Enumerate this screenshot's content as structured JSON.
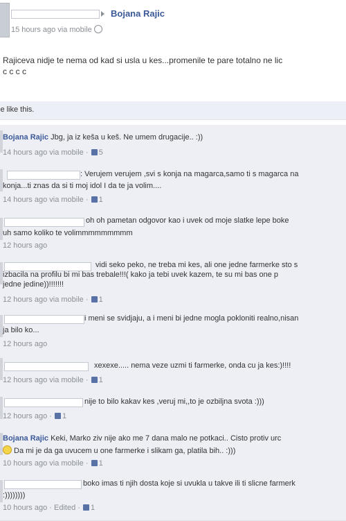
{
  "post": {
    "author": "Bojana Rajic",
    "time": "15 hours ago via mobile",
    "text_line1": "Rajiceva nidje te nema od kad si usla u kes...promenile te pare totalno ne lic",
    "text_line2": "c c c c",
    "likes_text": "le like this."
  },
  "comments": [
    {
      "author": "Bojana Rajic",
      "text1": "Jbg, ja iz keša u keš. Ne umem drugacije.. :))",
      "text2": "",
      "time": "14 hours ago via mobile",
      "likes": "5"
    },
    {
      "author": "",
      "text1": ": Verujem verujem ,svi s konja na magarca,samo ti s magarca na",
      "text2": "konja...ti znas da si ti moj idol I da te ja volim....",
      "time": "14 hours ago via mobile",
      "likes": "1"
    },
    {
      "author": "",
      "text1": "oh oh pametan odgovor kao i uvek od moje slatke lepe boke",
      "text2": "uh samo koliko te volimmmmmmmmm",
      "time": "12 hours ago",
      "likes": ""
    },
    {
      "author": "",
      "text1": "vidi seko peko, ne treba mi kes, ali one jedne farmerke sto s",
      "text2": "izbacila na profilu bi mi bas trebale!!!( kako ja tebi uvek kazem, te su mi bas one p",
      "text3": "jedne jedine))!!!!!!!",
      "time": "12 hours ago via mobile",
      "likes": "1"
    },
    {
      "author": "",
      "text1": "i meni se svidjaju, a i meni bi jedne mogla pokloniti realno,nisan",
      "text2": "ja bilo ko...",
      "time": "12 hours ago",
      "likes": ""
    },
    {
      "author": "",
      "text1": "xexexe..... nema veze uzmi ti farmerke, onda cu ja kes:)!!!!",
      "text2": "",
      "time": "12 hours ago via mobile",
      "likes": "1"
    },
    {
      "author": "",
      "text1": "nije to bilo kakav kes ,veruj mi,,to je ozbiljna svota :)))",
      "text2": "",
      "time": "12 hours ago",
      "likes": "1"
    },
    {
      "author": "Bojana Rajic",
      "text1": "Keki, Marko ziv nije ako me 7 dana malo ne potkaci.. Cisto protiv urc",
      "text2": "Da mi je da ga uvucem u one farmerke i slikam ga, platila bih.. :)))",
      "time": "10 hours ago via mobile",
      "likes": "1"
    },
    {
      "author": "",
      "text1": "boko imas ti njih dosta koje si uvukla u takve ili ti slicne farmerk",
      "text2": ":))))))))",
      "time": "10 hours ago",
      "edited": "Edited",
      "likes": "1"
    }
  ],
  "colors": {
    "link": "#3b5998",
    "comment_bg": "#edeff4",
    "meta": "#8a8f96"
  }
}
